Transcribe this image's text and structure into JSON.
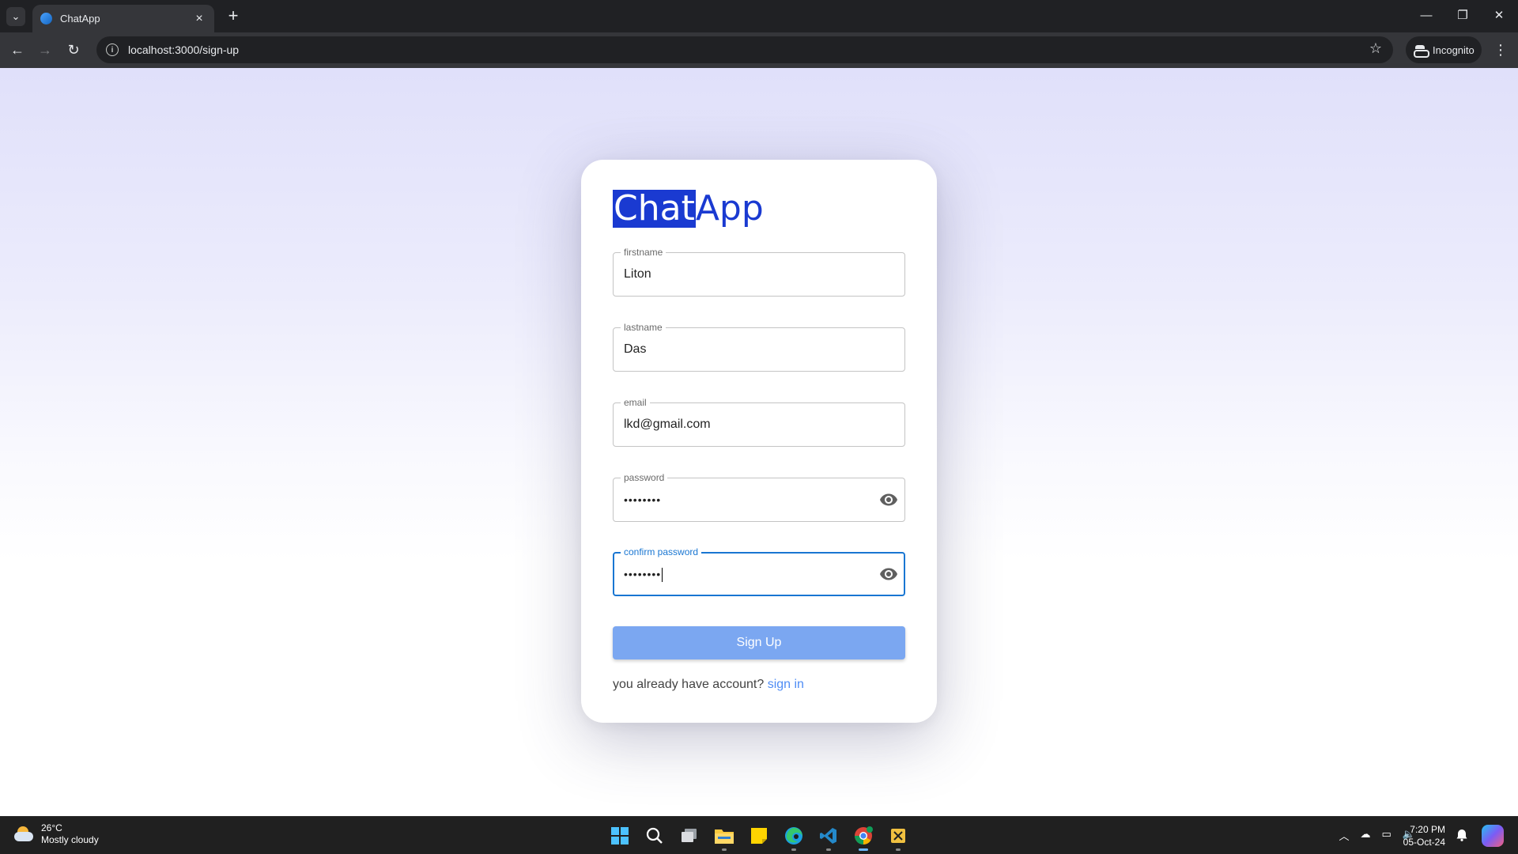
{
  "browser": {
    "tab_title": "ChatApp",
    "url": "localhost:3000/sign-up",
    "incognito_label": "Incognito",
    "icons": [
      "tab-search-icon",
      "favicon",
      "close-icon",
      "new-tab-icon",
      "minimize-icon",
      "restore-icon",
      "window-close-icon",
      "back-icon",
      "forward-icon",
      "reload-icon",
      "site-info-icon",
      "bookmark-star-icon",
      "incognito-icon",
      "menu-icon"
    ]
  },
  "logo": {
    "part1": "Chat",
    "part2": "App",
    "highlight_color": "#1a3ad1"
  },
  "form": {
    "firstname": {
      "label": "firstname",
      "value": "Liton"
    },
    "lastname": {
      "label": "lastname",
      "value": "Das"
    },
    "email": {
      "label": "email",
      "value": "lkd@gmail.com"
    },
    "password": {
      "label": "password",
      "value": "••••••••"
    },
    "confirm_password": {
      "label": "confirm password",
      "value": "••••••••",
      "focused": true
    },
    "submit_label": "Sign Up",
    "signin_prompt": "you already have account?",
    "signin_link": "sign in"
  },
  "colors": {
    "accent": "#1976d2",
    "button": "#7ba7f1",
    "link": "#4f8df5"
  },
  "taskbar": {
    "temperature": "26°C",
    "weather": "Mostly cloudy",
    "time": "7:20 PM",
    "date": "05-Oct-24",
    "apps": [
      "start-icon",
      "search-icon",
      "task-view-icon",
      "file-explorer-icon",
      "sticky-notes-icon",
      "edge-icon",
      "vscode-icon",
      "chrome-icon",
      "snipping-tool-icon"
    ]
  }
}
